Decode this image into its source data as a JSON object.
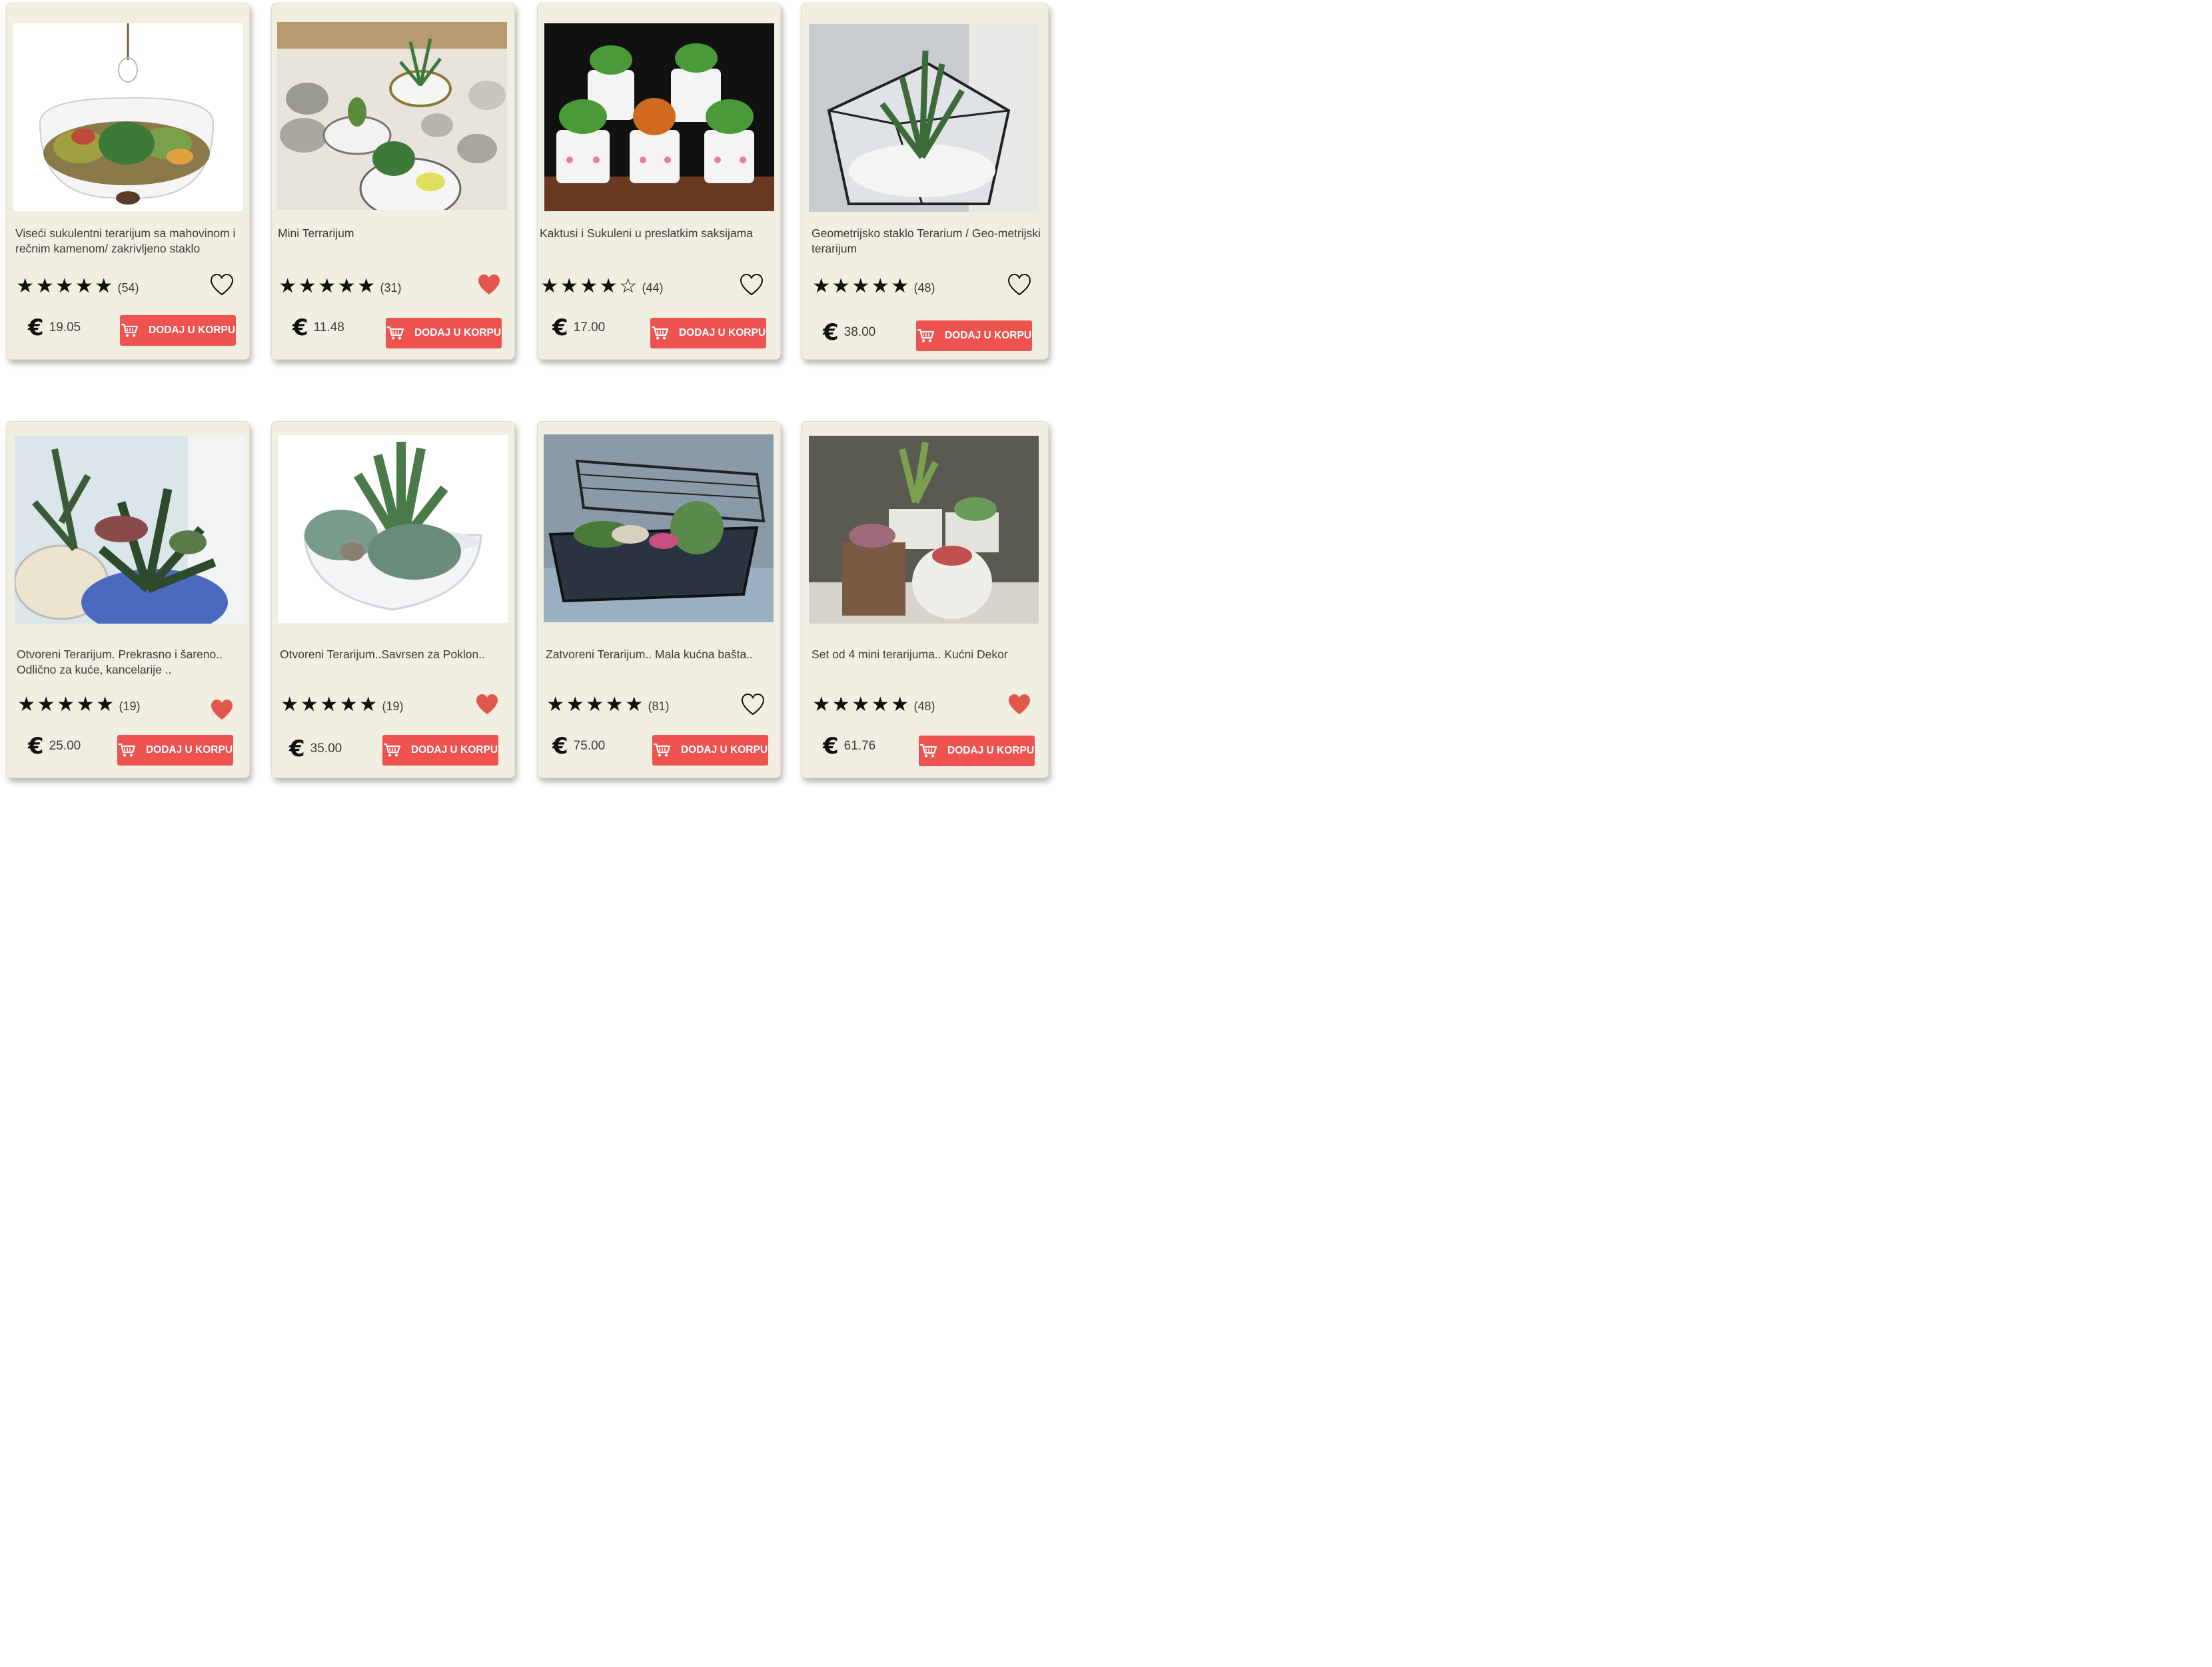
{
  "colors": {
    "card_bg": "#f1eee2",
    "button": "#ef5350",
    "heart_filled": "#e2574c",
    "text": "#3b3b3b"
  },
  "currency_symbol": "€",
  "cart_label": "DODAJ U KORPU",
  "products": [
    {
      "title": "Viseći sukulentni terarijum sa mahovinom i rečnim kamenom/ zakrivljeno staklo",
      "rating": 5,
      "reviews": "(54)",
      "price": "19.05",
      "favorited": false
    },
    {
      "title": "Mini Terrarijum",
      "rating": 5,
      "reviews": "(31)",
      "price": "11.48",
      "favorited": true
    },
    {
      "title": "Kaktusi i  Sukuleni u preslatkim saksijama",
      "rating": 4,
      "reviews": "(44)",
      "price": "17.00",
      "favorited": false
    },
    {
      "title": "Geometrijsko staklo Terarium / Geo-metrijski terarijum",
      "rating": 5,
      "reviews": "(48)",
      "price": "38.00",
      "favorited": false
    },
    {
      "title": "Otvoreni Terarijum. Prekrasno i šareno.. Odlično za kuće, kancelarije ..",
      "rating": 5,
      "reviews": "(19)",
      "price": "25.00",
      "favorited": true
    },
    {
      "title": "Otvoreni Terarijum..Savrsen za Poklon..",
      "rating": 5,
      "reviews": "(19)",
      "price": "35.00",
      "favorited": true
    },
    {
      "title": "Zatvoreni Terarijum.. Mala kućna bašta..",
      "rating": 5,
      "reviews": "(81)",
      "price": "75.00",
      "favorited": false
    },
    {
      "title": "Set od 4 mini terarijuma.. Kućni Dekor",
      "rating": 5,
      "reviews": "(48)",
      "price": "61.76",
      "favorited": true
    }
  ]
}
